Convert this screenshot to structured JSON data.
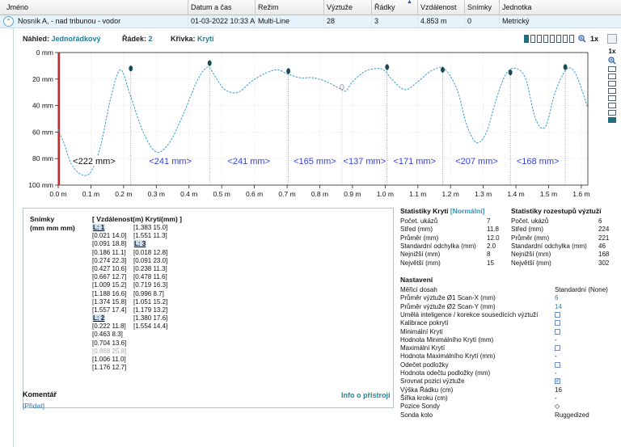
{
  "columns": [
    "Jméno",
    "Datum a čas",
    "Režim",
    "Výztuže",
    "Řádky",
    "Vzdálenost",
    "Snímky",
    "Jednotka"
  ],
  "row": {
    "name": "Nosník A, - nad tribunou - vodor",
    "date": "01-03-2022 10:33 AM",
    "mode": "Multi-Line",
    "rebars": "28",
    "lines": "3",
    "distance": "4.853 m",
    "snapshots": "0",
    "unit": "Metrický"
  },
  "preview": {
    "label": "Náhled:",
    "value": "Jednořádkový"
  },
  "line": {
    "label": "Řádek:",
    "value": "2"
  },
  "curve": {
    "label": "Křivka:",
    "value": "Krytí"
  },
  "zoom": {
    "top_label": "1x",
    "side_label": "1x",
    "level": 1
  },
  "chart_data": {
    "type": "line",
    "xlabel": "",
    "ylabel": "",
    "xlim": [
      0,
      1.62
    ],
    "ylim": [
      0,
      100
    ],
    "x_ticks": [
      "0.0 m",
      "0.1 m",
      "0.2 m",
      "0.3 m",
      "0.4 m",
      "0.5 m",
      "0.6 m",
      "0.7 m",
      "0.8 m",
      "0.9 m",
      "1.0 m",
      "1.1 m",
      "1.2 m",
      "1.3 m",
      "1.4 m",
      "1.5 m",
      "1.6 m"
    ],
    "y_ticks": [
      "0 mm",
      "20 mm",
      "40 mm",
      "60 mm",
      "80 mm",
      "100 mm"
    ],
    "curve_x": [
      0,
      0.02,
      0.04,
      0.07,
      0.1,
      0.13,
      0.16,
      0.19,
      0.22,
      0.26,
      0.3,
      0.34,
      0.38,
      0.42,
      0.44,
      0.46,
      0.48,
      0.51,
      0.55,
      0.59,
      0.63,
      0.67,
      0.7,
      0.74,
      0.78,
      0.82,
      0.86,
      0.88,
      0.9,
      0.94,
      0.98,
      1.0,
      1.02,
      1.06,
      1.1,
      1.14,
      1.18,
      1.22,
      1.25,
      1.28,
      1.31,
      1.34,
      1.37,
      1.4,
      1.43,
      1.46,
      1.49,
      1.52,
      1.55,
      1.57,
      1.59,
      1.62
    ],
    "curve_y": [
      58,
      70,
      84,
      92,
      90,
      70,
      35,
      13,
      32,
      60,
      75,
      68,
      48,
      24,
      15,
      11,
      18,
      28,
      30,
      22,
      16,
      13,
      16,
      19,
      19,
      22,
      27,
      29,
      22,
      14,
      12,
      14,
      20,
      28,
      22,
      14,
      12,
      28,
      55,
      68,
      60,
      35,
      16,
      12,
      20,
      50,
      56,
      30,
      14,
      12,
      20,
      42
    ],
    "rebars": [
      {
        "x": 0.222,
        "y": 12
      },
      {
        "x": 0.463,
        "y": 8
      },
      {
        "x": 0.704,
        "y": 14
      },
      {
        "x": 0.868,
        "y": 26,
        "dim": true
      },
      {
        "x": 1.006,
        "y": 11
      },
      {
        "x": 1.176,
        "y": 13
      },
      {
        "x": 1.383,
        "y": 15
      },
      {
        "x": 1.551,
        "y": 11
      }
    ],
    "spacing_labels": [
      {
        "x": 0.11,
        "text": "<222 mm>",
        "highlight": true
      },
      {
        "x": 0.343,
        "text": "<241 mm>"
      },
      {
        "x": 0.583,
        "text": "<241 mm>"
      },
      {
        "x": 0.785,
        "text": "<165 mm>"
      },
      {
        "x": 0.937,
        "text": "<137 mm>"
      },
      {
        "x": 1.09,
        "text": "<171 mm>"
      },
      {
        "x": 1.28,
        "text": "<207 mm>"
      },
      {
        "x": 1.467,
        "text": "<168 mm>"
      }
    ]
  },
  "snimky": {
    "title": "Snímky",
    "units": "(mm  mm  mm)",
    "col_header": "[ Vzdálenost(m)  Krytí(mm) ]",
    "col1": [
      {
        "t": "L: 1",
        "h": true
      },
      {
        "t": "[0.021  14.0]"
      },
      {
        "t": "[0.091  18.8]"
      },
      {
        "t": "[0.186  11.1]"
      },
      {
        "t": "[0.274  22.3]"
      },
      {
        "t": "[0.427  10.6]"
      },
      {
        "t": "[0.667  12.7]"
      },
      {
        "t": "[1.009  15.2]"
      },
      {
        "t": "[1.188  16.6]"
      },
      {
        "t": "[1.374  15.8]"
      },
      {
        "t": "[1.557  17.4]"
      },
      {
        "t": "L: 2",
        "h": true
      },
      {
        "t": "[0.222  11.8]"
      },
      {
        "t": "[0.463  8.3]"
      },
      {
        "t": "[0.704  13.6]"
      },
      {
        "t": "[0.868  25.8]",
        "dim": true
      },
      {
        "t": "[1.006  11.0]"
      },
      {
        "t": "[1.176  12.7]"
      }
    ],
    "col2": [
      {
        "t": "[1.383  15.0]"
      },
      {
        "t": "[1.551  11.3]"
      },
      {
        "t": "L: 3",
        "h": true
      },
      {
        "t": "[0.018  12.8]"
      },
      {
        "t": "[0.091  23.0]"
      },
      {
        "t": "[0.238  11.3]"
      },
      {
        "t": "[0.478  11.6]"
      },
      {
        "t": "[0.719  16.3]"
      },
      {
        "t": "[0.996  8.7]"
      },
      {
        "t": "[1.051  15.2]"
      },
      {
        "t": "[1.179  13.2]"
      },
      {
        "t": "[1.380  17.6]"
      },
      {
        "t": "[1.554  14.4]"
      }
    ]
  },
  "comment": {
    "label": "Komentář",
    "add": "[Přidat]"
  },
  "info_link": "Info o přístroji",
  "stats_cover": {
    "title": "Statistiky Krytí",
    "mode": "[Normální]",
    "rows": [
      [
        "Počet. ukázů",
        "7"
      ],
      [
        "Střed (mm)",
        "11.8"
      ],
      [
        "Průměr (mm)",
        "12.0"
      ],
      [
        "Standardní odchylka (mm)",
        "2.0"
      ],
      [
        "Nejnižší (mm)",
        "8"
      ],
      [
        "Největší (mm)",
        "15"
      ]
    ]
  },
  "stats_spacing": {
    "title": "Statistiky rozestupů výztuží",
    "rows": [
      [
        "Počet. ukázů",
        "6"
      ],
      [
        "Střed (mm)",
        "224"
      ],
      [
        "Průměr (mm)",
        "221"
      ],
      [
        "Standardní odchylka (mm)",
        "46"
      ],
      [
        "Nejnižší (mm)",
        "168"
      ],
      [
        "Největší (mm)",
        "302"
      ]
    ]
  },
  "settings": {
    "title": "Nastavení",
    "rows": [
      {
        "label": "Měřicí dosah",
        "value": "Standardní (None)",
        "kind": "text"
      },
      {
        "label": "Průměr výztuže Ø1 Scan-X (mm)",
        "value": "6",
        "kind": "blue"
      },
      {
        "label": "Průměr výztuže Ø2 Scan-Y (mm)",
        "value": "14",
        "kind": "blue"
      },
      {
        "label": "Umělá inteligence / korekce sousedících výztuží",
        "value": "",
        "kind": "check"
      },
      {
        "label": "Kalibrace pokrytí",
        "value": "",
        "kind": "check"
      },
      {
        "label": "Minimální Krytí",
        "value": "",
        "kind": "check"
      },
      {
        "label": "  Hodnota Minimálního Krytí (mm)",
        "value": "-",
        "kind": "text"
      },
      {
        "label": "Maximální Krytí",
        "value": "",
        "kind": "check"
      },
      {
        "label": "  Hodnota Maximálního Krytí (mm)",
        "value": "-",
        "kind": "text"
      },
      {
        "label": "Odečet podložky",
        "value": "",
        "kind": "check"
      },
      {
        "label": "  Hodnota  odečtu podložky (mm)",
        "value": "-",
        "kind": "text"
      },
      {
        "label": "Srovnat pozici výztuže",
        "value": "✓",
        "kind": "checked"
      },
      {
        "label": "Výška Řádku (cm)",
        "value": "16",
        "kind": "text"
      },
      {
        "label": "Šířka kroku (cm)",
        "value": "-",
        "kind": "text"
      },
      {
        "label": "Pozice Sondy",
        "value": "◇",
        "kind": "text"
      },
      {
        "label": "Sonda kolo",
        "value": "Ruggedized",
        "kind": "text"
      }
    ]
  }
}
